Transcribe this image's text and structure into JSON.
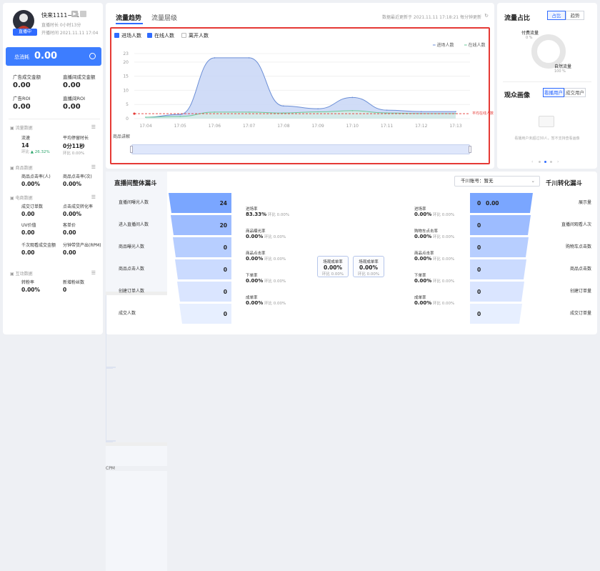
{
  "header": {
    "name": "快来1111~01",
    "live_badge": "直播中",
    "duration": "直播时长 0小时13分",
    "start_time": "开播时间 2021.11.11 17:04"
  },
  "left": {
    "total_label": "总消耗",
    "total_value": "0.00",
    "ad_deal_label": "广告成交金额",
    "ad_deal_value": "0.00",
    "live_deal_label": "直播间成交金额",
    "live_deal_value": "0.00",
    "ad_roi_label": "广告ROI",
    "ad_roi_value": "0.00",
    "live_roi_label": "直播间ROI",
    "live_roi_value": "0.00",
    "sec1": "流量数据",
    "flow_label": "流速",
    "flow_value": "14",
    "flow_sub": "环比",
    "flow_change": "▲ 26.32%",
    "stay_label": "平均停留时长",
    "stay_value": "0分11秒",
    "stay_sub": "环比 0.00%",
    "sec2": "商品数据",
    "pclick_label": "商品点击率(人)",
    "pclick_value": "0.00%",
    "pdeal_label": "商品点击率(次)",
    "pdeal_value": "0.00%",
    "sec3": "电商数据",
    "orders_label": "成交订单数",
    "orders_value": "0.00",
    "ctr_label": "点击成交转化率",
    "ctr_value": "0.00%",
    "uv_label": "UV价值",
    "uv_value": "0.00",
    "unit_label": "客单价",
    "unit_value": "0.00",
    "gpm_label": "千次观看成交金额",
    "gpm_value": "0.00",
    "rpm_label": "分钟带货产出(RPM)",
    "rpm_value": "0.00",
    "sec4": "互动数据",
    "fans_rate_label": "转粉率",
    "fans_rate_value": "0.00%",
    "fans_label": "新增粉丝数",
    "fans_value": "0"
  },
  "center": {
    "tab_trend": "流量趋势",
    "tab_level": "流量层级",
    "updated": "数据最近更新于 2021.11.11 17:18:21  每分钟更新",
    "cb_enter": "进场人数",
    "cb_online": "在线人数",
    "cb_leave": "离开人数",
    "legend_enter": "进场人数",
    "legend_online": "在线人数",
    "avg_label": "平均在线人数 1",
    "product_explain": "商品讲解"
  },
  "chart_data": {
    "type": "area",
    "x": [
      "17:04",
      "17:05",
      "17:06",
      "17:07",
      "17:08",
      "17:09",
      "17:10",
      "17:11",
      "17:12",
      "17:13"
    ],
    "yticks": [
      0,
      5,
      10,
      15,
      20,
      23
    ],
    "ylim": [
      0,
      23
    ],
    "series": [
      {
        "name": "进场人数",
        "values": [
          0.5,
          1.5,
          21.5,
          21.5,
          4.5,
          3.5,
          7.5,
          3,
          2.5,
          2.5
        ]
      },
      {
        "name": "在线人数",
        "values": [
          0.5,
          0.8,
          2.3,
          2.3,
          2,
          2.4,
          2.8,
          2,
          1.8,
          1.8
        ]
      }
    ],
    "avg_line": 1
  },
  "right": {
    "title": "流量占比",
    "btn_ratio": "占比",
    "btn_trend": "趋势",
    "paid_label": "付费流量",
    "paid_value": "0 %",
    "natural_label": "自然流量",
    "natural_value": "100 %",
    "audience_title": "观众画像",
    "btn_watch": "看播用户",
    "btn_deal": "成交用户",
    "empty_note": "看播用户未超过30人，暂不支持查看画像"
  },
  "bottom": {
    "title": "直播间整体漏斗",
    "account_label": "千川账号：",
    "account_value": "暂无",
    "right_title": "千川转化漏斗",
    "funnel_left": [
      {
        "label": "直播间曝光人数",
        "value": "24"
      },
      {
        "label": "进入直播间人数",
        "value": "20"
      },
      {
        "label": "商品曝光人数",
        "value": "0"
      },
      {
        "label": "商品点击人数",
        "value": "0"
      },
      {
        "label": "创建订单人数",
        "value": "0"
      },
      {
        "label": "成交人数",
        "value": "0"
      }
    ],
    "rates_left": [
      {
        "title": "进场率",
        "value": "83.33%",
        "hb": "环比 0.00%"
      },
      {
        "title": "商品曝光率",
        "value": "0.00%",
        "hb": "环比 0.00%"
      },
      {
        "title": "商品点击率",
        "value": "0.00%",
        "hb": "环比 0.00%"
      },
      {
        "title": "下单率",
        "value": "0.00%",
        "hb": "环比 0.00%"
      },
      {
        "title": "成单率",
        "value": "0.00%",
        "hb": "环比 0.00%"
      }
    ],
    "mid_left": {
      "title": "场观成单率",
      "value": "0.00%",
      "hb": "环比 0.00%"
    },
    "mid_right": {
      "title": "场观成单率",
      "value": "0.00%",
      "hb": "环比 0.00%"
    },
    "rates_right": [
      {
        "title": "进场率",
        "value": "0.00%",
        "hb": "环比 0.00%"
      },
      {
        "title": "购物车点击率",
        "value": "0.00%",
        "hb": "环比 0.00%"
      },
      {
        "title": "商品点击率",
        "value": "0.00%",
        "hb": "环比 0.00%"
      },
      {
        "title": "下单率",
        "value": "0.00%",
        "hb": "环比 0.00%"
      },
      {
        "title": "成单率",
        "value": "0.00%",
        "hb": "环比 0.00%"
      }
    ],
    "funnel_right": [
      {
        "label": "展示量",
        "value": "0",
        "extra": "0.00",
        "unit": "CPM"
      },
      {
        "label": "直播间观看人次",
        "value": "0"
      },
      {
        "label": "购物车点击数",
        "value": "0"
      },
      {
        "label": "商品点击数",
        "value": "0"
      },
      {
        "label": "创建订单量",
        "value": "0"
      },
      {
        "label": "成交订单量",
        "value": "0"
      }
    ]
  },
  "colors": {
    "accent": "#2f6bff",
    "enter_line": "#6b8ed6",
    "online_line": "#6cc99a",
    "highlight": "#e53935"
  }
}
